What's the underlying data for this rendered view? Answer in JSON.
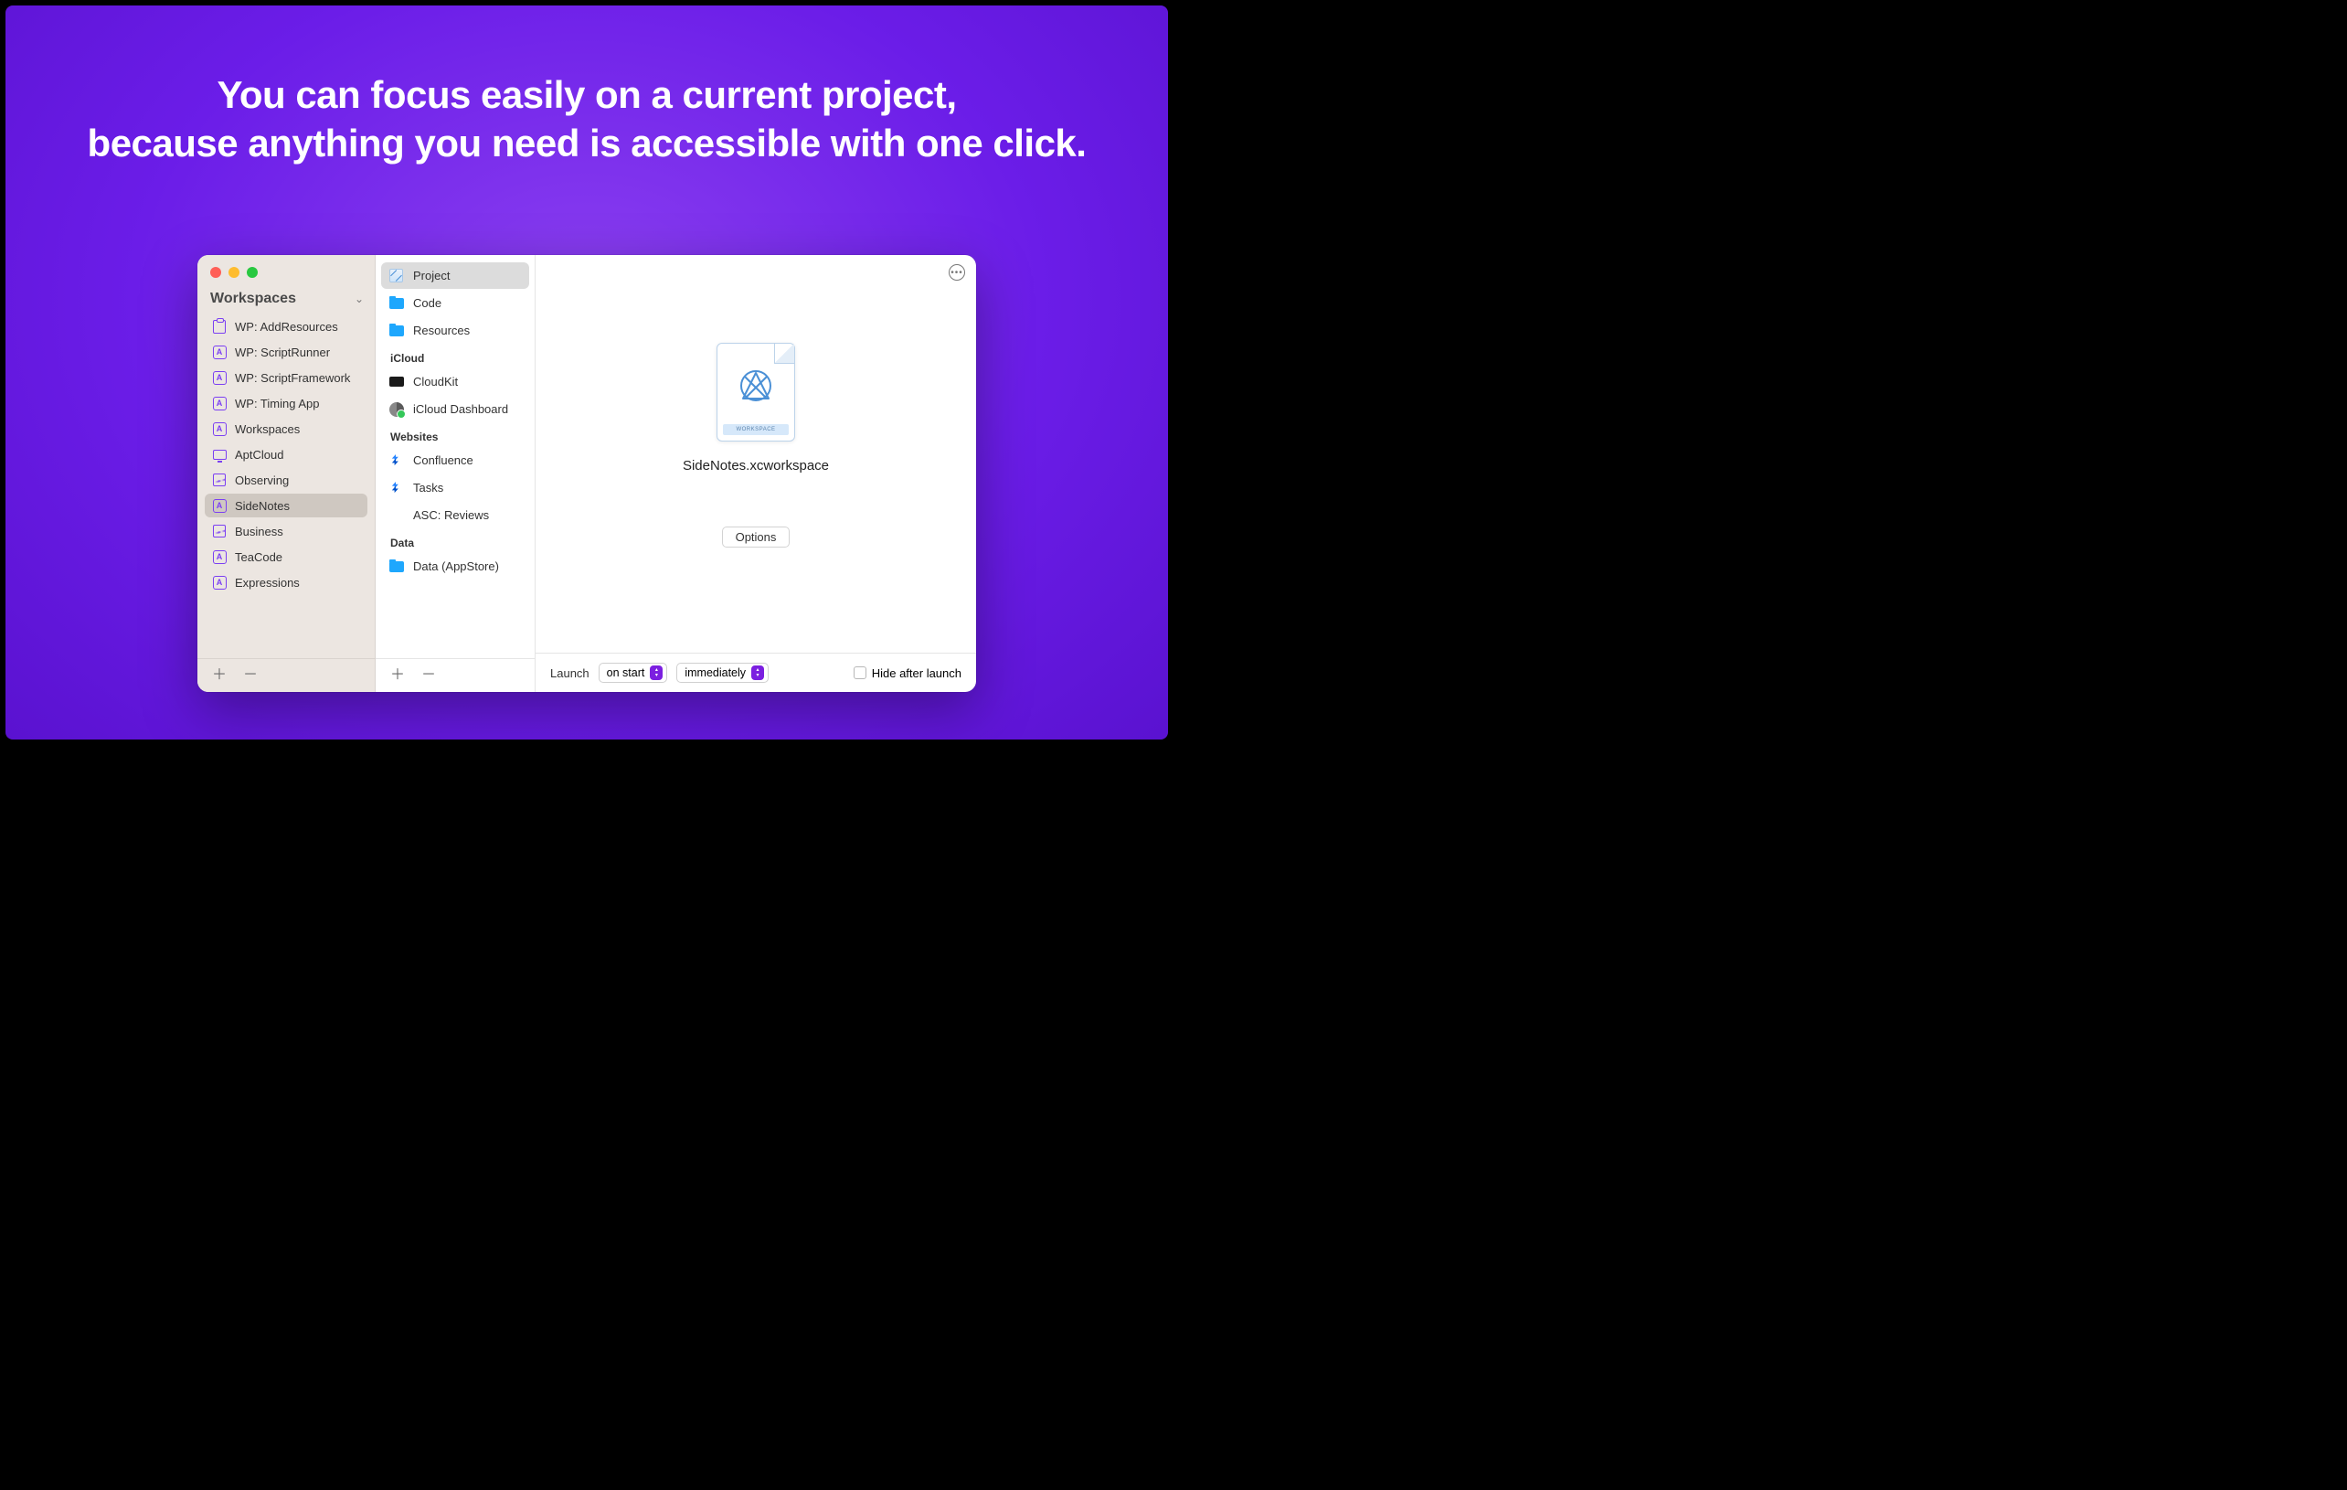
{
  "headline": "You can focus easily on a current project,\nbecause anything you need is accessible with one click.",
  "sidebar": {
    "title": "Workspaces",
    "items": [
      {
        "label": "WP: AddResources",
        "icon": "clipboard"
      },
      {
        "label": "WP: ScriptRunner",
        "icon": "a-box"
      },
      {
        "label": "WP: ScriptFramework",
        "icon": "a-box"
      },
      {
        "label": "WP: Timing App",
        "icon": "a-box"
      },
      {
        "label": "Workspaces",
        "icon": "a-box"
      },
      {
        "label": "AptCloud",
        "icon": "monitor"
      },
      {
        "label": "Observing",
        "icon": "chart"
      },
      {
        "label": "SideNotes",
        "icon": "a-box",
        "selected": true
      },
      {
        "label": "Business",
        "icon": "chart"
      },
      {
        "label": "TeaCode",
        "icon": "a-box"
      },
      {
        "label": "Expressions",
        "icon": "a-box"
      }
    ]
  },
  "middle": {
    "groups": [
      {
        "header": null,
        "items": [
          {
            "label": "Project",
            "icon": "xcode",
            "selected": true
          },
          {
            "label": "Code",
            "icon": "folder"
          },
          {
            "label": "Resources",
            "icon": "folder"
          }
        ]
      },
      {
        "header": "iCloud",
        "items": [
          {
            "label": "CloudKit",
            "icon": "black-rect"
          },
          {
            "label": "iCloud Dashboard",
            "icon": "gear-badge"
          }
        ]
      },
      {
        "header": "Websites",
        "items": [
          {
            "label": "Confluence",
            "icon": "jira"
          },
          {
            "label": "Tasks",
            "icon": "jira"
          },
          {
            "label": "ASC: Reviews",
            "icon": "apple"
          }
        ]
      },
      {
        "header": "Data",
        "items": [
          {
            "label": "Data (AppStore)",
            "icon": "folder"
          }
        ]
      }
    ]
  },
  "detail": {
    "file_band": "WORKSPACE",
    "filename": "SideNotes.xcworkspace",
    "options_label": "Options",
    "launch_label": "Launch",
    "launch_when": "on start",
    "launch_delay": "immediately",
    "hide_label": "Hide after launch"
  }
}
